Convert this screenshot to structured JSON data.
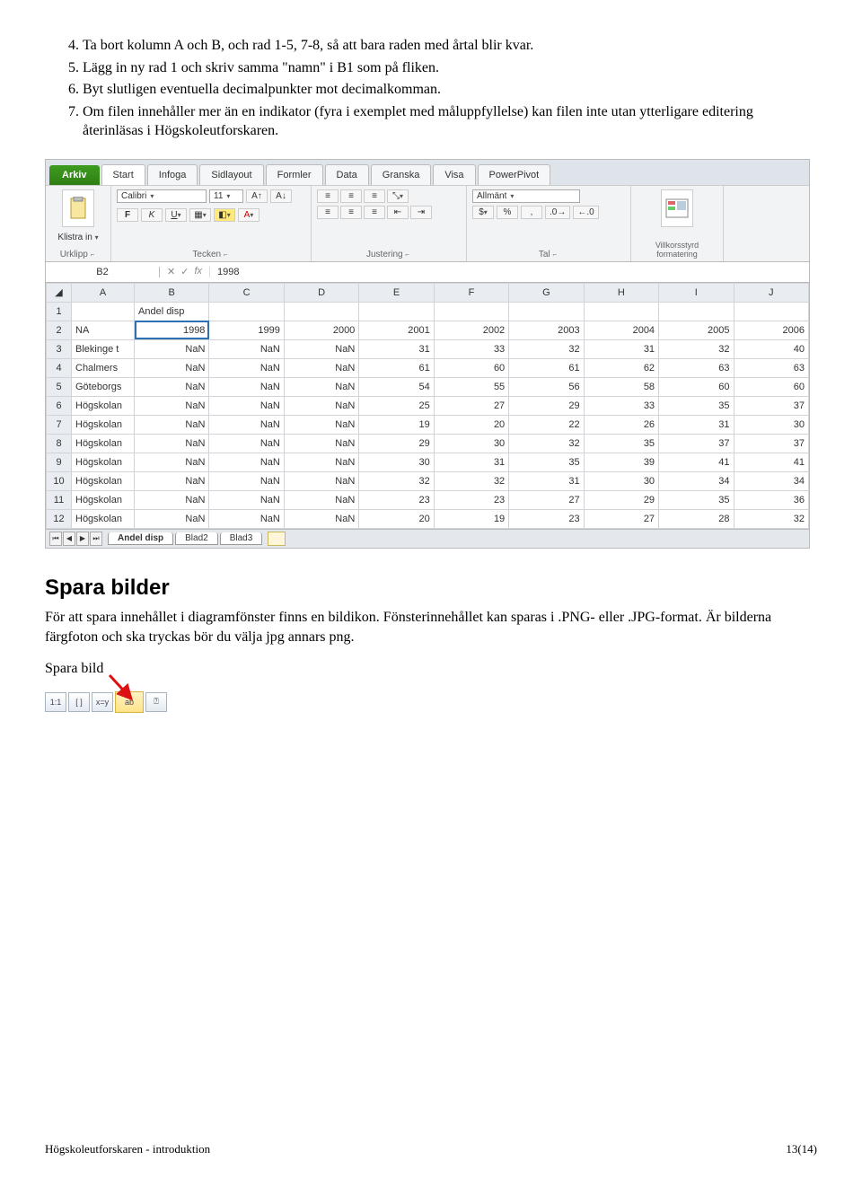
{
  "list": {
    "i4": "Ta bort kolumn A och B, och rad 1-5, 7-8, så att bara raden med årtal blir kvar.",
    "i5": "Lägg in ny rad 1 och skriv samma \"namn\" i B1 som på fliken.",
    "i6": "Byt slutligen eventuella decimalpunkter mot decimalkomman.",
    "i7": "Om filen innehåller mer än en indikator (fyra i exemplet med måluppfyllelse) kan filen inte utan ytterligare editering återinläsas i Högskoleutforskaren."
  },
  "excel": {
    "tab_arkiv": "Arkiv",
    "tabs": [
      "Start",
      "Infoga",
      "Sidlayout",
      "Formler",
      "Data",
      "Granska",
      "Visa",
      "PowerPivot"
    ],
    "klistra": "Klistra in",
    "urklipp": "Urklipp",
    "tecken": "Tecken",
    "justering": "Justering",
    "tal": "Tal",
    "font": "Calibri",
    "size": "11",
    "allmant": "Allmänt",
    "villkor": "Villkorsstyrd formatering",
    "namebox": "B2",
    "fx": "fx",
    "fxval": "1998",
    "cols": [
      "A",
      "B",
      "C",
      "D",
      "E",
      "F",
      "G",
      "H",
      "I",
      "J"
    ],
    "rows": [
      {
        "n": "1",
        "a": "",
        "b": "Andel disp",
        "c": "",
        "d": "",
        "e": "",
        "f": "",
        "g": "",
        "h": "",
        "i": "",
        "j": ""
      },
      {
        "n": "2",
        "a": "NA",
        "b": "1998",
        "c": "1999",
        "d": "2000",
        "e": "2001",
        "f": "2002",
        "g": "2003",
        "h": "2004",
        "i": "2005",
        "j": "2006"
      },
      {
        "n": "3",
        "a": "Blekinge t",
        "b": "NaN",
        "c": "NaN",
        "d": "NaN",
        "e": "31",
        "f": "33",
        "g": "32",
        "h": "31",
        "i": "32",
        "j": "40"
      },
      {
        "n": "4",
        "a": "Chalmers",
        "b": "NaN",
        "c": "NaN",
        "d": "NaN",
        "e": "61",
        "f": "60",
        "g": "61",
        "h": "62",
        "i": "63",
        "j": "63"
      },
      {
        "n": "5",
        "a": "Göteborgs",
        "b": "NaN",
        "c": "NaN",
        "d": "NaN",
        "e": "54",
        "f": "55",
        "g": "56",
        "h": "58",
        "i": "60",
        "j": "60"
      },
      {
        "n": "6",
        "a": "Högskolan",
        "b": "NaN",
        "c": "NaN",
        "d": "NaN",
        "e": "25",
        "f": "27",
        "g": "29",
        "h": "33",
        "i": "35",
        "j": "37"
      },
      {
        "n": "7",
        "a": "Högskolan",
        "b": "NaN",
        "c": "NaN",
        "d": "NaN",
        "e": "19",
        "f": "20",
        "g": "22",
        "h": "26",
        "i": "31",
        "j": "30"
      },
      {
        "n": "8",
        "a": "Högskolan",
        "b": "NaN",
        "c": "NaN",
        "d": "NaN",
        "e": "29",
        "f": "30",
        "g": "32",
        "h": "35",
        "i": "37",
        "j": "37"
      },
      {
        "n": "9",
        "a": "Högskolan",
        "b": "NaN",
        "c": "NaN",
        "d": "NaN",
        "e": "30",
        "f": "31",
        "g": "35",
        "h": "39",
        "i": "41",
        "j": "41"
      },
      {
        "n": "10",
        "a": "Högskolan",
        "b": "NaN",
        "c": "NaN",
        "d": "NaN",
        "e": "32",
        "f": "32",
        "g": "31",
        "h": "30",
        "i": "34",
        "j": "34"
      },
      {
        "n": "11",
        "a": "Högskolan",
        "b": "NaN",
        "c": "NaN",
        "d": "NaN",
        "e": "23",
        "f": "23",
        "g": "27",
        "h": "29",
        "i": "35",
        "j": "36"
      },
      {
        "n": "12",
        "a": "Högskolan",
        "b": "NaN",
        "c": "NaN",
        "d": "NaN",
        "e": "20",
        "f": "19",
        "g": "23",
        "h": "27",
        "i": "28",
        "j": "32"
      }
    ],
    "sheets": [
      "Andel disp",
      "Blad2",
      "Blad3"
    ]
  },
  "section_title": "Spara bilder",
  "section_body": "För att spara innehållet i diagramfönster finns en bildikon. Fönsterinnehållet kan sparas i .PNG- eller .JPG-format. Är bilderna färgfoton och ska tryckas bör du välja jpg annars png.",
  "spara_bild": "Spara bild",
  "toolbar": {
    "i1": "1:1",
    "i2": "[ ]",
    "i3": "x=y",
    "i4": "ab",
    "i5": "⍰"
  },
  "footer_left": "Högskoleutforskaren - introduktion",
  "footer_right": "13(14)"
}
